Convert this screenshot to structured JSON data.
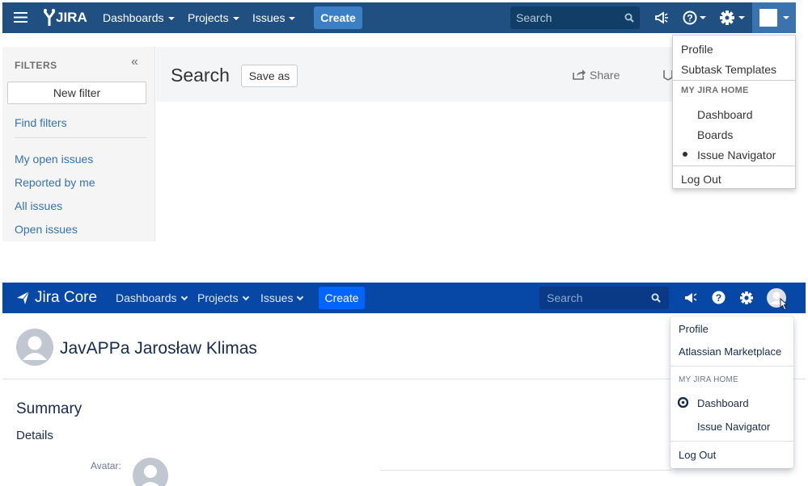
{
  "panel_old": {
    "header": {
      "logo_text": "JIRA",
      "nav": [
        "Dashboards",
        "Projects",
        "Issues"
      ],
      "create_label": "Create",
      "search_placeholder": "Search"
    },
    "sidebar": {
      "title": "FILTERS",
      "collapse_glyph": "«",
      "new_filter_label": "New filter",
      "find_filters_label": "Find filters",
      "items": [
        "My open issues",
        "Reported by me",
        "All issues",
        "Open issues"
      ]
    },
    "content": {
      "page_title": "Search",
      "save_as_label": "Save as",
      "share_label": "Share"
    },
    "user_menu": {
      "profile": "Profile",
      "subtask_templates": "Subtask Templates",
      "home_heading": "MY JIRA HOME",
      "home_options": [
        "Dashboard",
        "Boards",
        "Issue Navigator"
      ],
      "selected_home": "Issue Navigator",
      "logout": "Log Out"
    }
  },
  "panel_new": {
    "header": {
      "logo_text": "Jira Core",
      "nav": [
        "Dashboards",
        "Projects",
        "Issues"
      ],
      "create_label": "Create",
      "search_placeholder": "Search"
    },
    "profile": {
      "user_name": "JavAPPa Jarosław Klimas",
      "summary_heading": "Summary",
      "details_heading": "Details",
      "avatar_label": "Avatar:"
    },
    "user_menu": {
      "profile": "Profile",
      "marketplace": "Atlassian Marketplace",
      "home_heading": "MY JIRA HOME",
      "home_options": [
        "Dashboard",
        "Issue Navigator"
      ],
      "selected_home": "Dashboard",
      "logout": "Log Out"
    }
  },
  "colors": {
    "old_header": "#205081",
    "old_create": "#3b7fc4",
    "new_header": "#0747a6",
    "new_create": "#0065ff",
    "link": "#3572b0"
  }
}
